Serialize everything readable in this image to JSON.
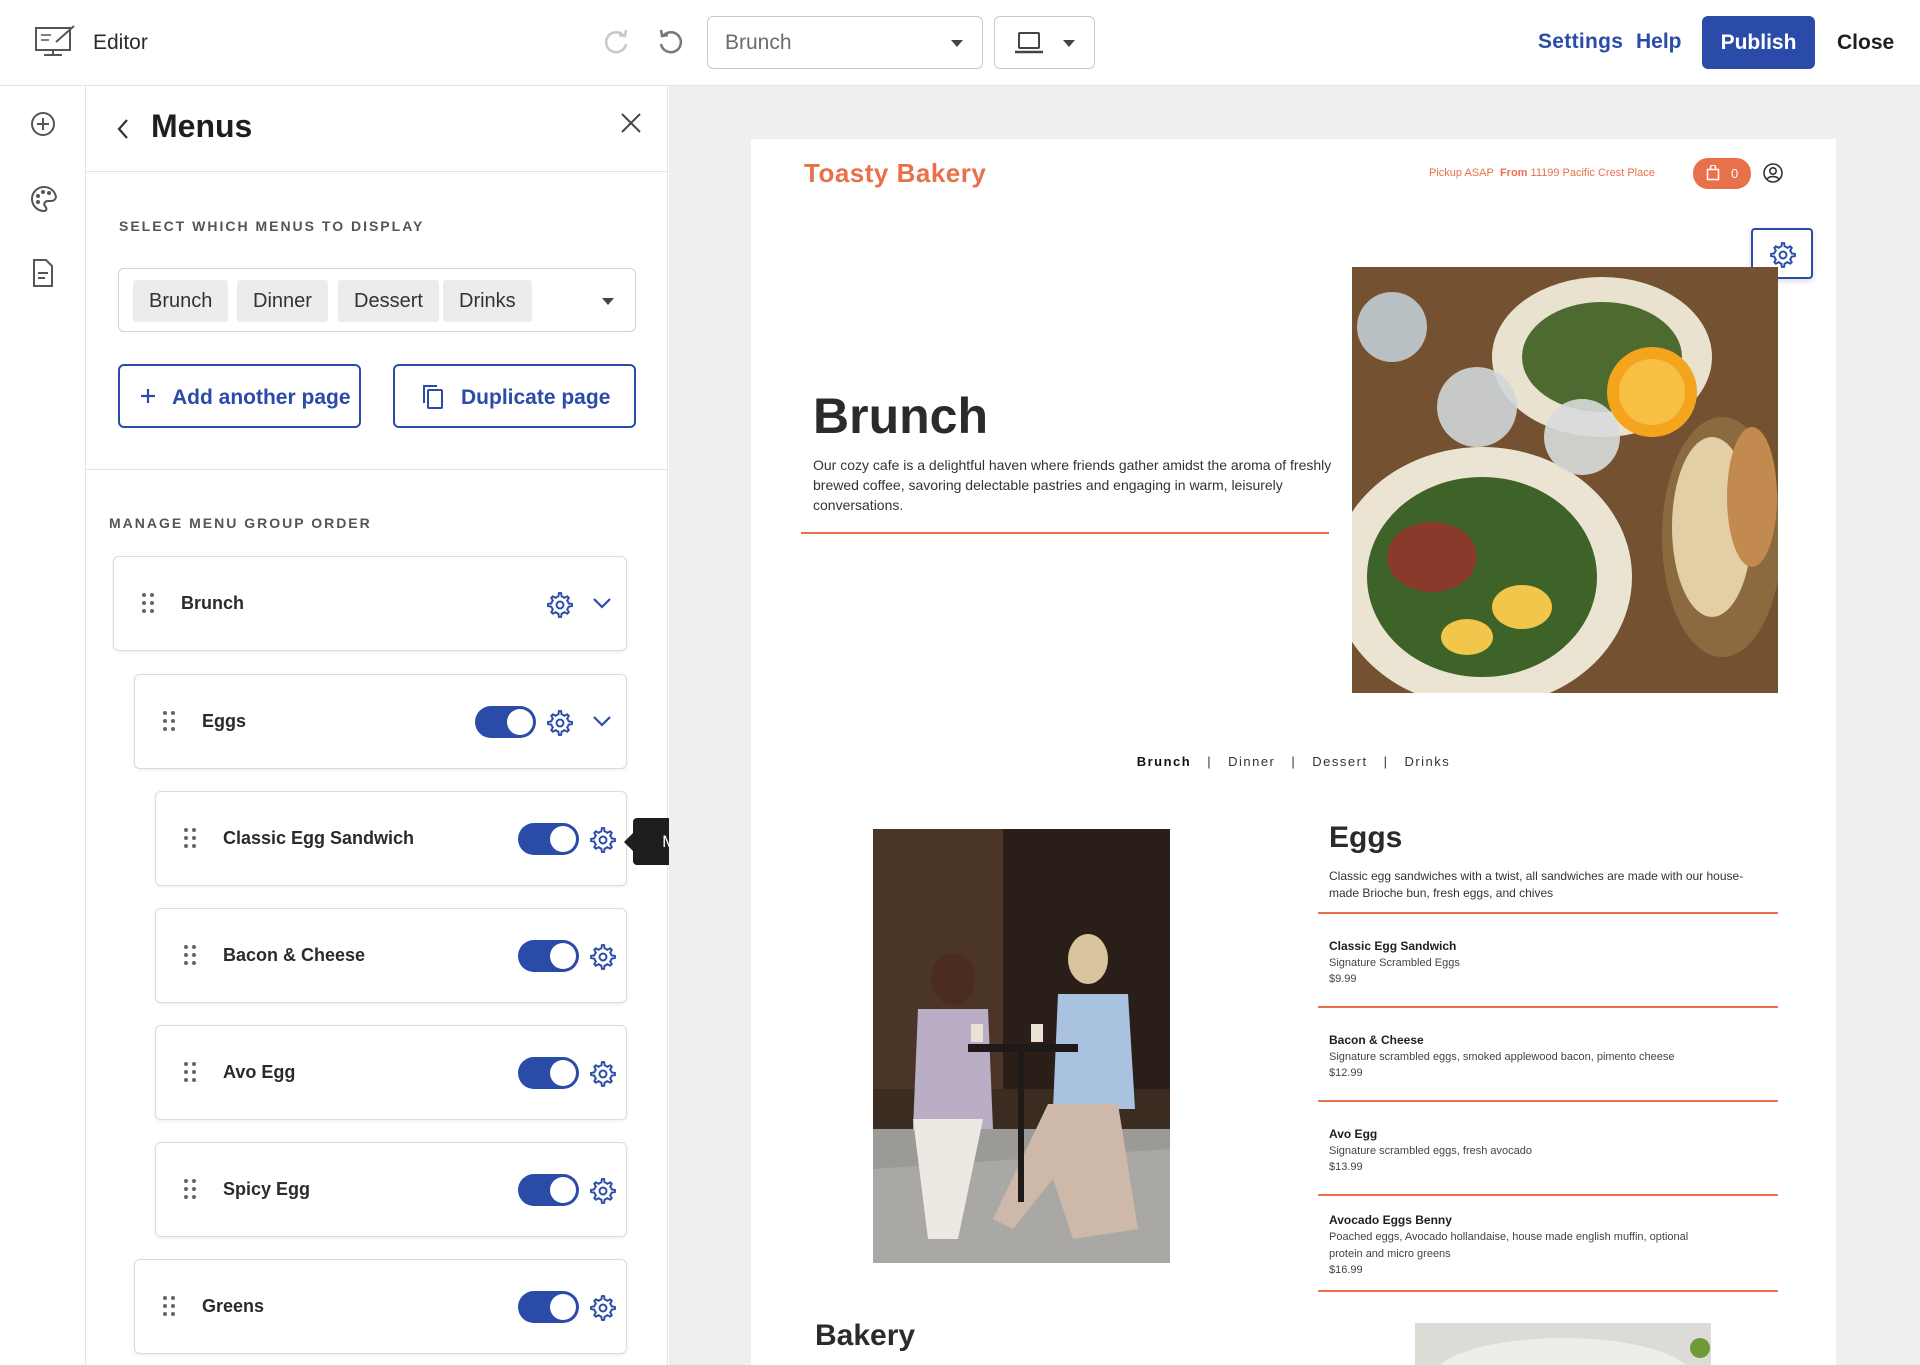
{
  "topbar": {
    "editor_label": "Editor",
    "page_select_value": "Brunch",
    "settings": "Settings",
    "help": "Help",
    "publish": "Publish",
    "close": "Close"
  },
  "rail": {
    "icons": [
      "add-icon",
      "palette-icon",
      "page-icon"
    ]
  },
  "panel": {
    "title": "Menus",
    "select_label": "SELECT WHICH MENUS TO DISPLAY",
    "chips": [
      "Brunch",
      "Dinner",
      "Dessert",
      "Drinks"
    ],
    "add_page": "Add another page",
    "duplicate_page": "Duplicate page",
    "order_label": "MANAGE MENU GROUP ORDER",
    "groups": [
      {
        "label": "Brunch",
        "toggle": null
      },
      {
        "label": "Eggs",
        "toggle": true
      },
      {
        "label": "Classic Egg Sandwich",
        "toggle": true
      },
      {
        "label": "Bacon & Cheese",
        "toggle": true
      },
      {
        "label": "Avo Egg",
        "toggle": true
      },
      {
        "label": "Spicy Egg",
        "toggle": true
      },
      {
        "label": "Greens",
        "toggle": true
      }
    ],
    "tooltip": "Menu item formatting"
  },
  "preview": {
    "brand": "Toasty Bakery",
    "pickup_prefix": "Pickup ASAP",
    "pickup_from": "From",
    "pickup_address": "11199 Pacific Crest Place",
    "cart_count": "0",
    "hero_title": "Brunch",
    "hero_desc": "Our cozy cafe is a delightful haven where friends gather amidst the aroma of freshly brewed coffee, savoring delectable pastries and engaging in warm, leisurely conversations.",
    "tabs": [
      "Brunch",
      "Dinner",
      "Dessert",
      "Drinks"
    ],
    "section_title": "Eggs",
    "section_desc": "Classic egg sandwiches with a twist, all sandwiches are made with our house-made Brioche bun, fresh eggs, and chives",
    "items": [
      {
        "name": "Classic Egg Sandwich",
        "desc": "Signature Scrambled Eggs",
        "price": "$9.99"
      },
      {
        "name": "Bacon & Cheese",
        "desc": "Signature scrambled eggs, smoked applewood bacon, pimento cheese",
        "price": "$12.99"
      },
      {
        "name": "Avo Egg",
        "desc": "Signature scrambled eggs, fresh avocado",
        "price": "$13.99"
      },
      {
        "name": "Avocado Eggs Benny",
        "desc": "Poached eggs, Avocado hollandaise, house made english muffin, optional protein and micro greens",
        "price": "$16.99"
      }
    ],
    "next_section_title": "Bakery"
  },
  "colors": {
    "accent": "#2a4ba8",
    "brand": "#e8704a"
  }
}
